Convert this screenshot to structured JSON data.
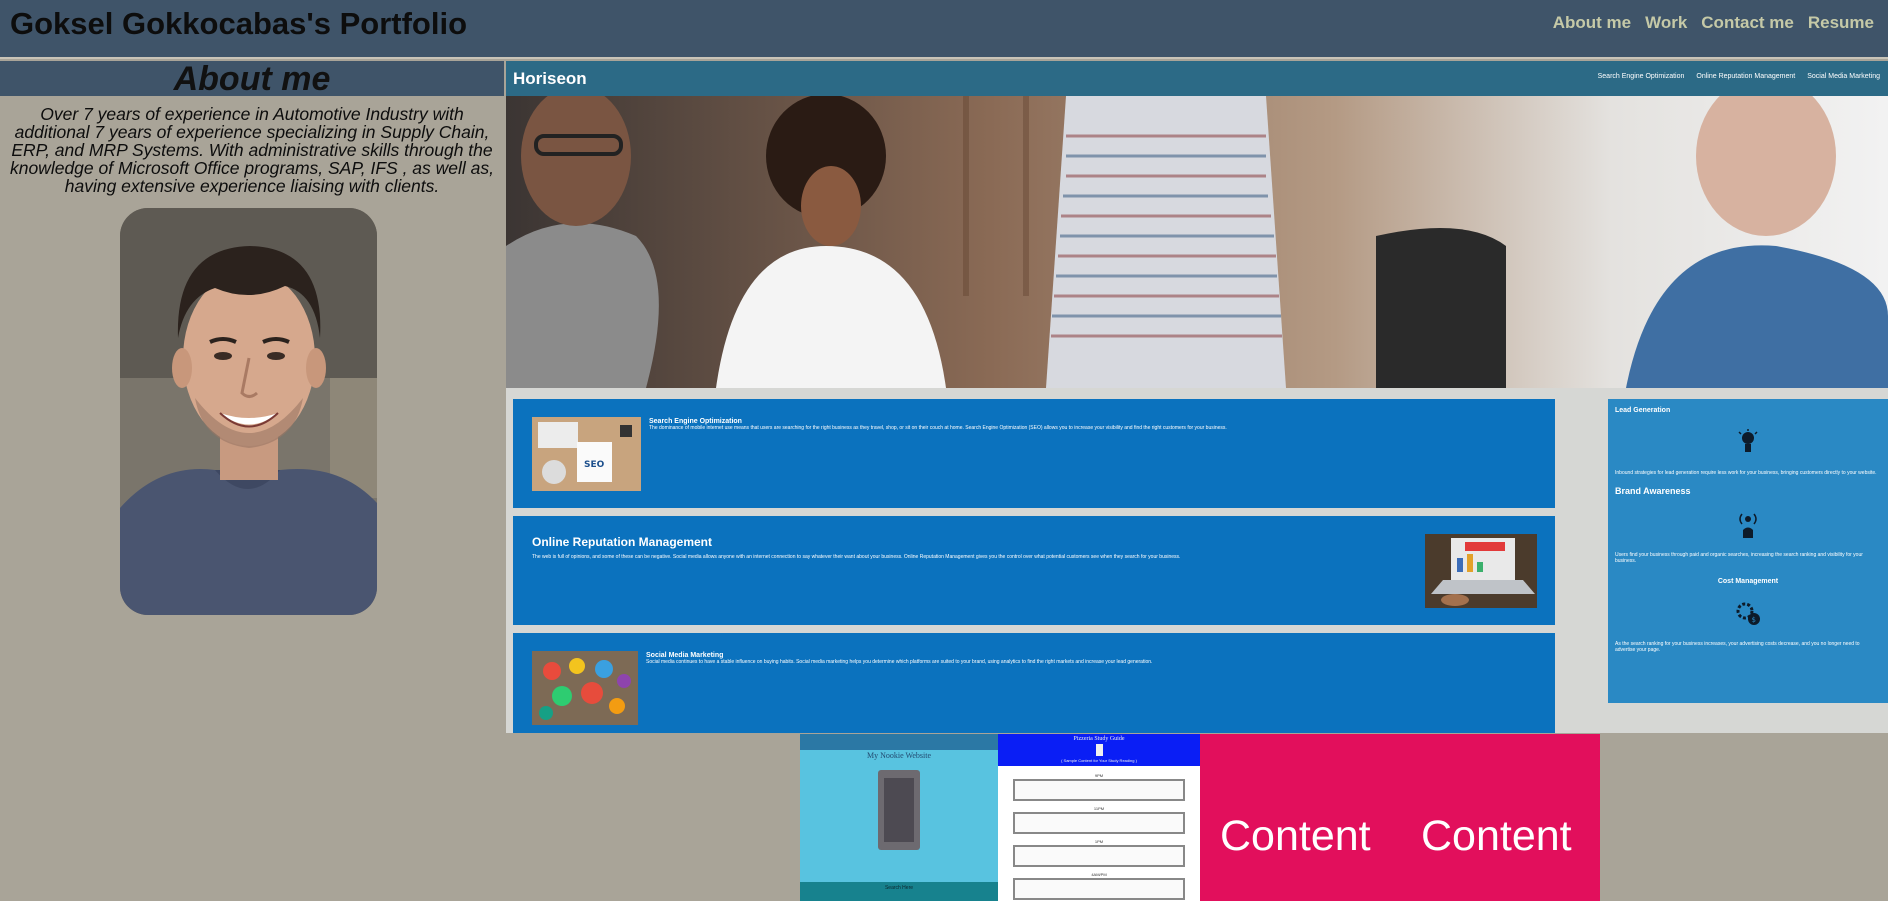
{
  "header": {
    "title": "Goksel Gokkocabas's Portfolio",
    "nav": [
      "About me",
      "Work",
      "Contact me",
      "Resume"
    ]
  },
  "about": {
    "heading": "About me",
    "text": "Over 7 years of experience in Automotive Industry with additional 7 years of experience specializing in Supply Chain, ERP, and MRP Systems. With administrative skills through the knowledge of Microsoft Office programs, SAP, IFS , as well as, having extensive experience liaising with clients.",
    "photo_icon": "portrait-photo"
  },
  "horiseon": {
    "logo": "Horiseon",
    "nav": [
      "Search Engine Optimization",
      "Online Reputation Management",
      "Social Media Marketing"
    ],
    "cards": [
      {
        "title": "Search Engine Optimization",
        "body": "The dominance of mobile internet use means that users are searching for the right business as they travel, shop, or sit on their couch at home. Search Engine Optimization (SEO) allows you to increase your visibility and find the right customers for your business."
      },
      {
        "title": "Online Reputation Management",
        "body": "The web is full of opinions, and some of these can be negative. Social media allows anyone with an internet connection to say whatever their want about your business. Online Reputation Management gives you the control over what potential customers see when they search for your business."
      },
      {
        "title": "Social Media Marketing",
        "body": "Social media continues to have a stable influence on buying habits. Social media marketing helps you determine which platforms are suited to your brand, using analytics to find the right markets and increase your lead generation."
      }
    ],
    "benefits": [
      {
        "title": "Lead Generation",
        "body": "Inbound strategies for lead generation require less work for your business, bringing customers directly to your website."
      },
      {
        "title": "Brand Awareness",
        "body": "Users find your business through paid and organic searches, increasing the search ranking and visibility for your business."
      },
      {
        "title": "Cost Management",
        "body": "As the search ranking for your business increases, your advertising costs decrease, and you no longer need to advertise your page."
      }
    ]
  },
  "work": {
    "nookie": {
      "title": "My Nookie Website",
      "button": "Search Here"
    },
    "planner": {
      "title": "Pizzeria Study Guide",
      "subtitle": "( Sample Content for Your Study Reading )",
      "hours": [
        "9PM",
        "11PM",
        "1PM",
        "4AM/PM"
      ]
    },
    "content_words": [
      "Content",
      "Content"
    ]
  },
  "colors": {
    "page_bg": "#a9a498",
    "header_bg": "#3f5469",
    "nav_link": "#c5c9a7",
    "horiseon_header": "#2c6a86",
    "card_blue": "#0b72be",
    "aside_blue": "#2a89c4",
    "content_pink": "#e20f5c"
  }
}
